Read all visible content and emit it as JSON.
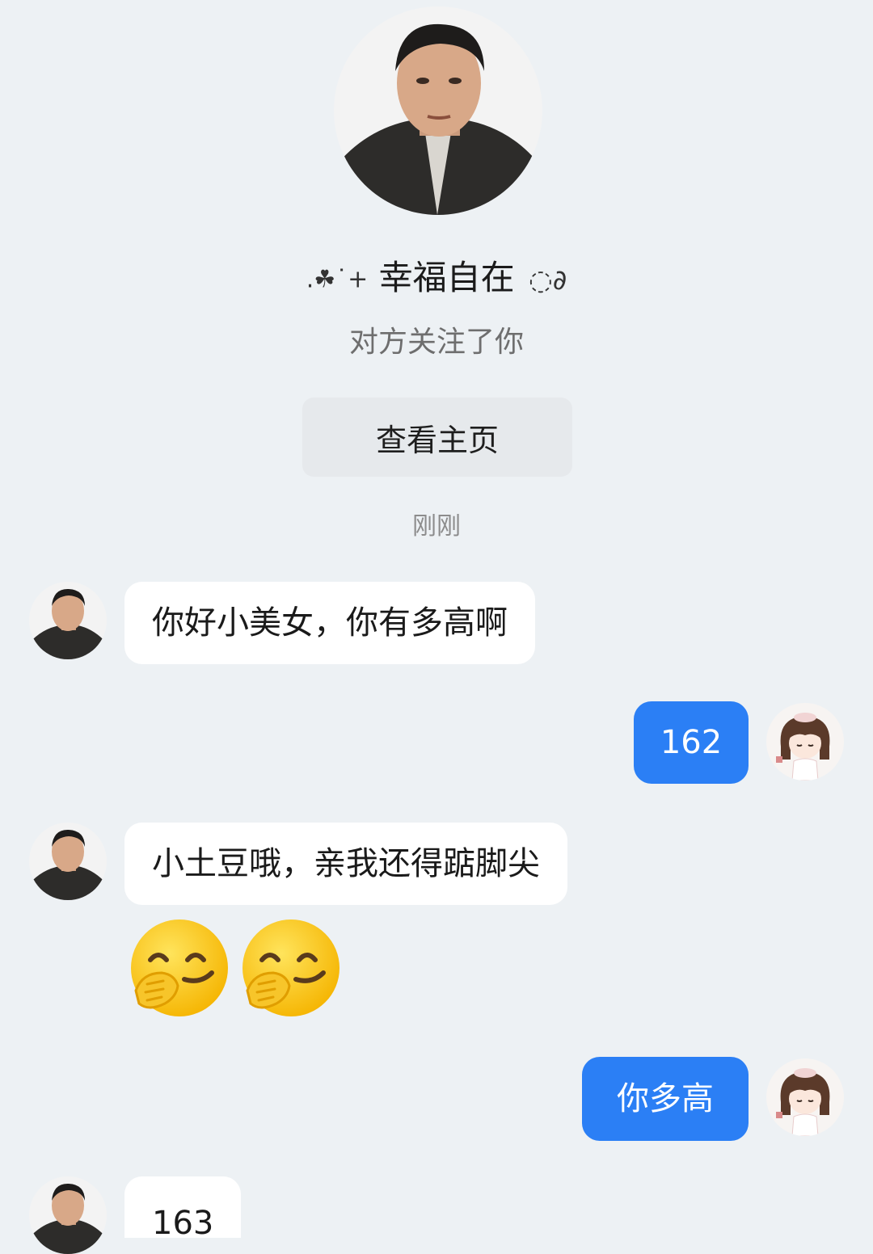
{
  "header": {
    "name": "幸福自在",
    "name_prefix": ".☘˙+",
    "name_suffix": "◌∂",
    "follow_status": "对方关注了你",
    "view_profile_label": "查看主页"
  },
  "timestamp": "刚刚",
  "messages": [
    {
      "from": "other",
      "text": "你好小美女，你有多高啊"
    },
    {
      "from": "me",
      "text": "162"
    },
    {
      "from": "other",
      "text": "小土豆哦，亲我还得踮脚尖"
    },
    {
      "from": "other",
      "emoji": [
        "face-with-hand-over-mouth",
        "face-with-hand-over-mouth"
      ]
    },
    {
      "from": "me",
      "text": "你多高"
    },
    {
      "from": "other",
      "text": "163"
    }
  ],
  "colors": {
    "background": "#edf1f4",
    "outgoing_bubble": "#2b7ff5",
    "incoming_bubble": "#ffffff",
    "button_bg": "#e6e9ec"
  }
}
